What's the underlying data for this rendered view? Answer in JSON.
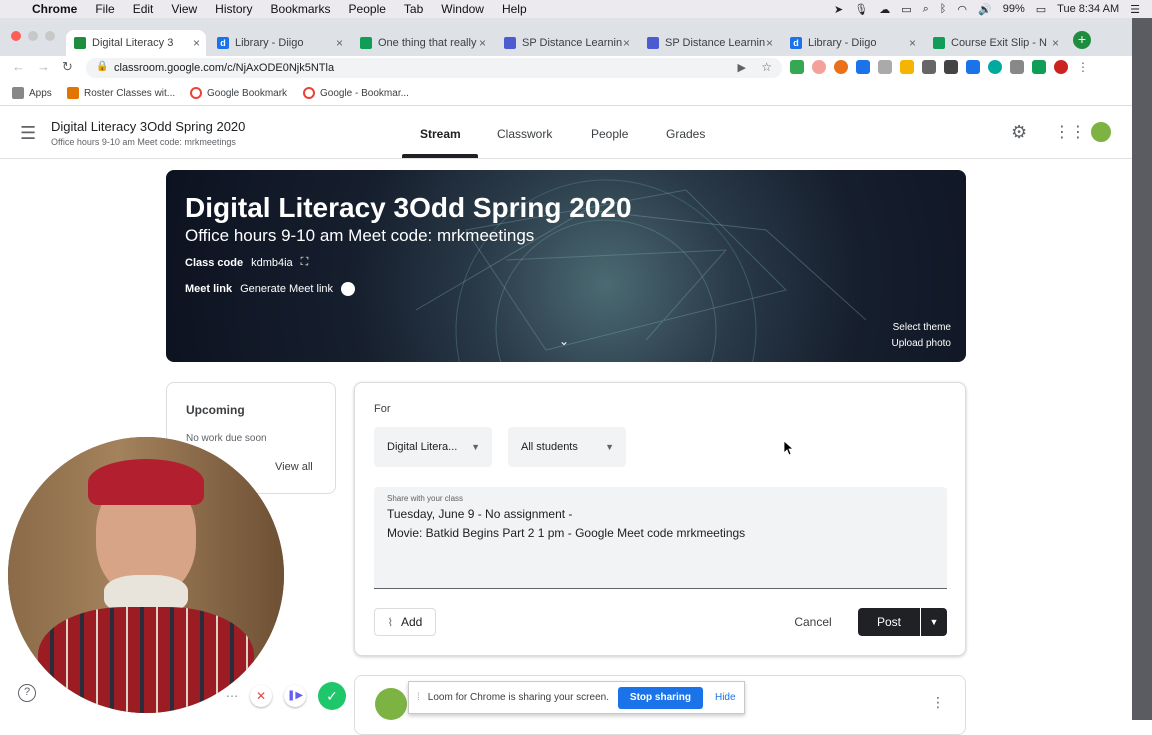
{
  "mac_menu": {
    "apple": "",
    "app": "Chrome",
    "items": [
      "File",
      "Edit",
      "View",
      "History",
      "Bookmarks",
      "People",
      "Tab",
      "Window",
      "Help"
    ],
    "battery": "99%",
    "clock": "Tue 8:34 AM"
  },
  "tabs": [
    {
      "label": "Digital Literacy 3",
      "color": "#1e8e3e",
      "glyph": ""
    },
    {
      "label": "Library - Diigo",
      "color": "#1a73e8",
      "glyph": "d"
    },
    {
      "label": "One thing that really",
      "color": "#0f9d58",
      "glyph": ""
    },
    {
      "label": "SP Distance Learning",
      "color": "#4d5bd1",
      "glyph": ""
    },
    {
      "label": "SP Distance Learning",
      "color": "#4d5bd1",
      "glyph": ""
    },
    {
      "label": "Library - Diigo",
      "color": "#1a73e8",
      "glyph": "d"
    },
    {
      "label": "Course Exit Slip - N",
      "color": "#0f9d58",
      "glyph": ""
    }
  ],
  "url": "classroom.google.com/c/NjAxODE0Njk5NTla",
  "bookmarks": [
    {
      "label": "Apps",
      "color": "#888"
    },
    {
      "label": "Roster Classes wit...",
      "color": "#e37400"
    },
    {
      "label": "Google Bookmark",
      "color": "#ea4335"
    },
    {
      "label": "Google - Bookmar...",
      "color": "#ea4335"
    }
  ],
  "classroom": {
    "class_name": "Digital Literacy 3Odd Spring 2020",
    "subtitle": "Office hours 9-10 am Meet code: mrkmeetings",
    "nav": [
      "Stream",
      "Classwork",
      "People",
      "Grades"
    ],
    "active_nav": "Stream"
  },
  "banner": {
    "title": "Digital Literacy 3Odd Spring 2020",
    "subtitle": "Office hours 9-10 am Meet code: mrkmeetings",
    "class_code_label": "Class code",
    "class_code": "kdmb4ia",
    "meet_link_label": "Meet link",
    "generate_meet_link": "Generate Meet link",
    "select_theme": "Select theme",
    "upload_photo": "Upload photo"
  },
  "upcoming": {
    "title": "Upcoming",
    "empty": "No work due soon",
    "view_all": "View all"
  },
  "composer": {
    "for_label": "For",
    "class_select": "Digital Litera...",
    "students_select": "All students",
    "share_label": "Share with your class",
    "text_line1": "Tuesday, June 9 - No assignment -",
    "text_line2": "Movie: Batkid Begins Part 2  1 pm  - Google Meet code mrkmeetings",
    "add": "Add",
    "cancel": "Cancel",
    "post": "Post"
  },
  "loom": {
    "message": "Loom for Chrome is sharing your screen.",
    "stop": "Stop sharing",
    "hide": "Hide"
  },
  "help": "?"
}
